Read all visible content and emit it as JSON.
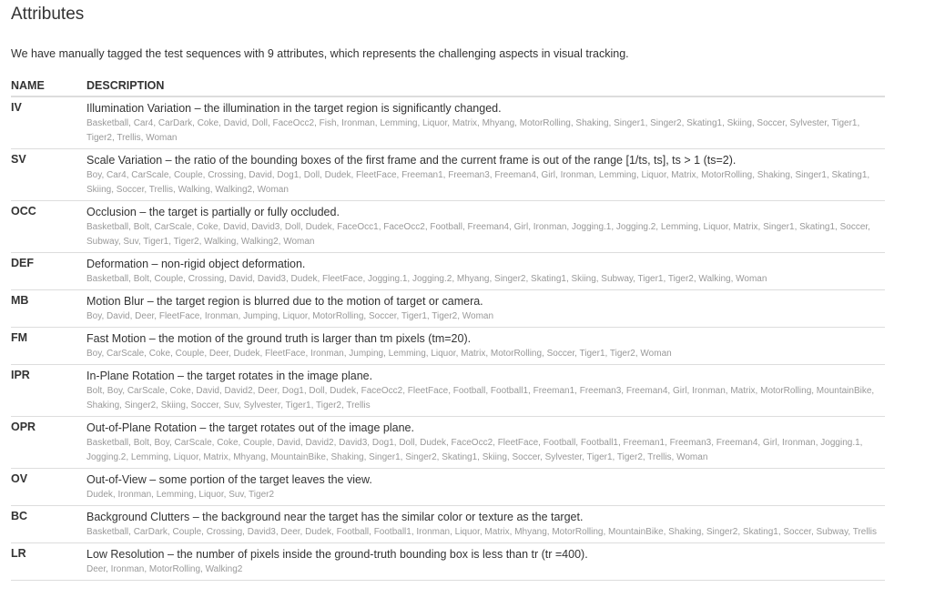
{
  "page": {
    "title": "Attributes",
    "intro": "We have manually tagged the test sequences with 9 attributes, which represents the challenging aspects in visual tracking."
  },
  "table": {
    "headers": {
      "name": "NAME",
      "description": "DESCRIPTION"
    },
    "rows": [
      {
        "code": "IV",
        "description": "Illumination Variation – the illumination in the target region is significantly changed.",
        "sequences": "Basketball, Car4, CarDark, Coke, David, Doll, FaceOcc2, Fish, Ironman, Lemming, Liquor, Matrix, Mhyang, MotorRolling, Shaking, Singer1, Singer2, Skating1, Skiing, Soccer, Sylvester, Tiger1, Tiger2, Trellis, Woman"
      },
      {
        "code": "SV",
        "description": "Scale Variation – the ratio of the bounding boxes of the first frame and the current frame is out of the range [1/ts, ts], ts > 1 (ts=2).",
        "sequences": "Boy, Car4, CarScale, Couple, Crossing, David, Dog1, Doll, Dudek, FleetFace, Freeman1, Freeman3, Freeman4, Girl, Ironman, Lemming, Liquor, Matrix, MotorRolling, Shaking, Singer1, Skating1, Skiing, Soccer, Trellis, Walking, Walking2, Woman"
      },
      {
        "code": "OCC",
        "description": "Occlusion – the target is partially or fully occluded.",
        "sequences": "Basketball, Bolt, CarScale, Coke, David, David3, Doll, Dudek, FaceOcc1, FaceOcc2, Football, Freeman4, Girl, Ironman, Jogging.1, Jogging.2, Lemming, Liquor, Matrix, Singer1, Skating1, Soccer, Subway, Suv, Tiger1, Tiger2, Walking, Walking2, Woman"
      },
      {
        "code": "DEF",
        "description": "Deformation – non-rigid object deformation.",
        "sequences": "Basketball, Bolt, Couple, Crossing, David, David3, Dudek, FleetFace, Jogging.1, Jogging.2, Mhyang, Singer2, Skating1, Skiing, Subway, Tiger1, Tiger2, Walking, Woman"
      },
      {
        "code": "MB",
        "description": "Motion Blur – the target region is blurred due to the motion of target or camera.",
        "sequences": "Boy, David, Deer, FleetFace, Ironman, Jumping, Liquor, MotorRolling, Soccer, Tiger1, Tiger2, Woman"
      },
      {
        "code": "FM",
        "description": "Fast Motion – the motion of the ground truth is larger than tm pixels (tm=20).",
        "sequences": "Boy, CarScale, Coke, Couple, Deer, Dudek, FleetFace, Ironman, Jumping, Lemming, Liquor, Matrix, MotorRolling, Soccer, Tiger1, Tiger2, Woman"
      },
      {
        "code": "IPR",
        "description": "In-Plane Rotation – the target rotates in the image plane.",
        "sequences": "Bolt, Boy, CarScale, Coke, David, David2, Deer, Dog1, Doll, Dudek, FaceOcc2, FleetFace, Football, Football1, Freeman1, Freeman3, Freeman4, Girl, Ironman, Matrix, MotorRolling, MountainBike, Shaking, Singer2, Skiing, Soccer, Suv, Sylvester, Tiger1, Tiger2, Trellis"
      },
      {
        "code": "OPR",
        "description": "Out-of-Plane Rotation – the target rotates out of the image plane.",
        "sequences": "Basketball, Bolt, Boy, CarScale, Coke, Couple, David, David2, David3, Dog1, Doll, Dudek, FaceOcc2, FleetFace, Football, Football1, Freeman1, Freeman3, Freeman4, Girl, Ironman, Jogging.1, Jogging.2, Lemming, Liquor, Matrix, Mhyang, MountainBike, Shaking, Singer1, Singer2, Skating1, Skiing, Soccer, Sylvester, Tiger1, Tiger2, Trellis, Woman"
      },
      {
        "code": "OV",
        "description": "Out-of-View – some portion of the target leaves the view.",
        "sequences": "Dudek, Ironman, Lemming, Liquor, Suv, Tiger2"
      },
      {
        "code": "BC",
        "description": "Background Clutters – the background near the target has the similar color or texture as the target.",
        "sequences": "Basketball, CarDark, Couple, Crossing, David3, Deer, Dudek, Football, Football1, Ironman, Liquor, Matrix, Mhyang, MotorRolling, MountainBike, Shaking, Singer2, Skating1, Soccer, Subway, Trellis"
      },
      {
        "code": "LR",
        "description": "Low Resolution – the number of pixels inside the ground-truth bounding box is less than tr (tr =400).",
        "sequences": "Deer, Ironman, MotorRolling, Walking2"
      }
    ]
  }
}
